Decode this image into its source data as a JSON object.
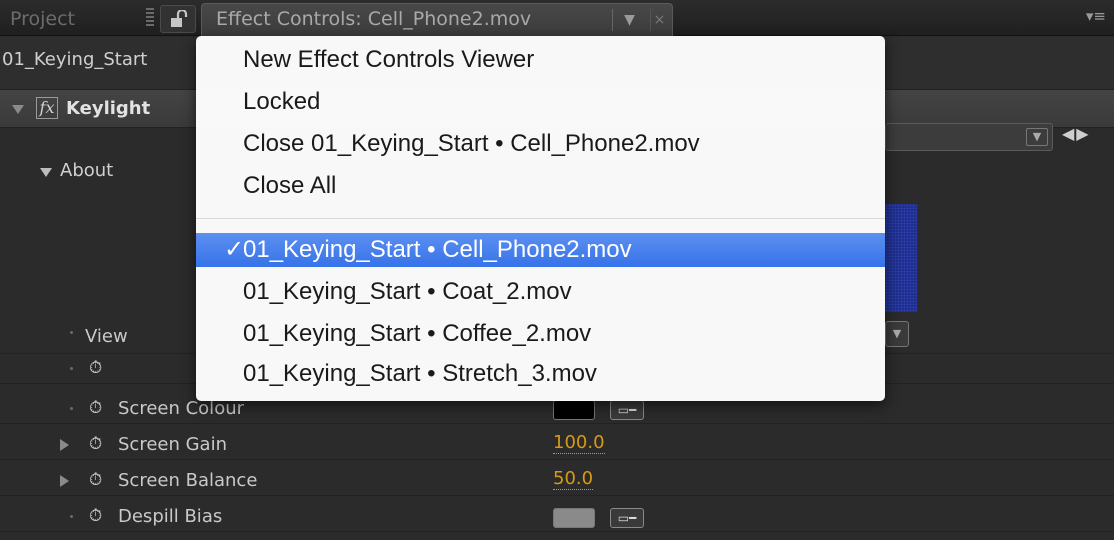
{
  "tabs": {
    "project": "Project",
    "active": "Effect Controls: Cell_Phone2.mov",
    "dropdown": "▼",
    "close": "×",
    "panel_menu": "▾≡"
  },
  "panel": {
    "comp_label": "01_Keying_Start",
    "effect_name": "Keylight",
    "about_label": "About",
    "nav_arrows": "◀▶",
    "rows": {
      "view": "View",
      "screen_colour": "Screen Colour",
      "screen_gain": "Screen Gain",
      "screen_gain_value": "100.0",
      "screen_balance": "Screen Balance",
      "screen_balance_value": "50.0",
      "despill_bias": "Despill Bias"
    }
  },
  "menu": {
    "actions": [
      "New Effect Controls Viewer",
      "Locked",
      "Close 01_Keying_Start • Cell_Phone2.mov",
      "Close All"
    ],
    "check_mark": "✓",
    "layers": [
      "01_Keying_Start • Cell_Phone2.mov",
      "01_Keying_Start • Coat_2.mov",
      "01_Keying_Start • Coffee_2.mov",
      "01_Keying_Start • Stretch_3.mov"
    ],
    "selected_index": 0
  },
  "colors": {
    "accent_selection": "#3673e9",
    "value_orange": "#d79a14",
    "screen_colour_swatch": "#000000",
    "despill_swatch": "#8a8a8a"
  }
}
